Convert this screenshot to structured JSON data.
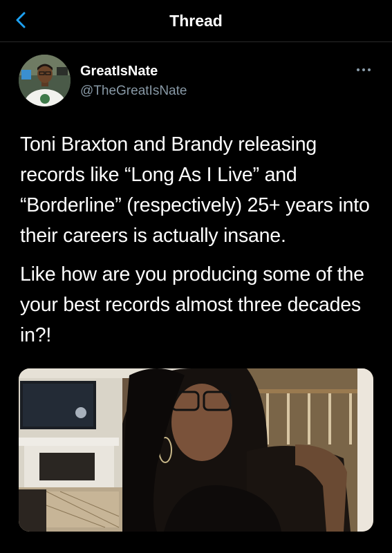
{
  "nav": {
    "title": "Thread"
  },
  "author": {
    "display_name": "GreatIsNate",
    "handle": "@TheGreatIsNate"
  },
  "tweet": {
    "paragraphs": [
      "Toni Braxton and Brandy releasing records like “Long As I Live” and “Borderline” (respectively) 25+ years into their careers is actually insane.",
      "Like how are you producing some of the your best records almost three decades in?!"
    ]
  },
  "icons": {
    "back": "chevron-left-icon",
    "more": "more-horizontal-icon"
  },
  "colors": {
    "background": "#000000",
    "accent": "#1da1f2",
    "secondary_text": "#8899a6",
    "divider": "#2a2a2a"
  }
}
